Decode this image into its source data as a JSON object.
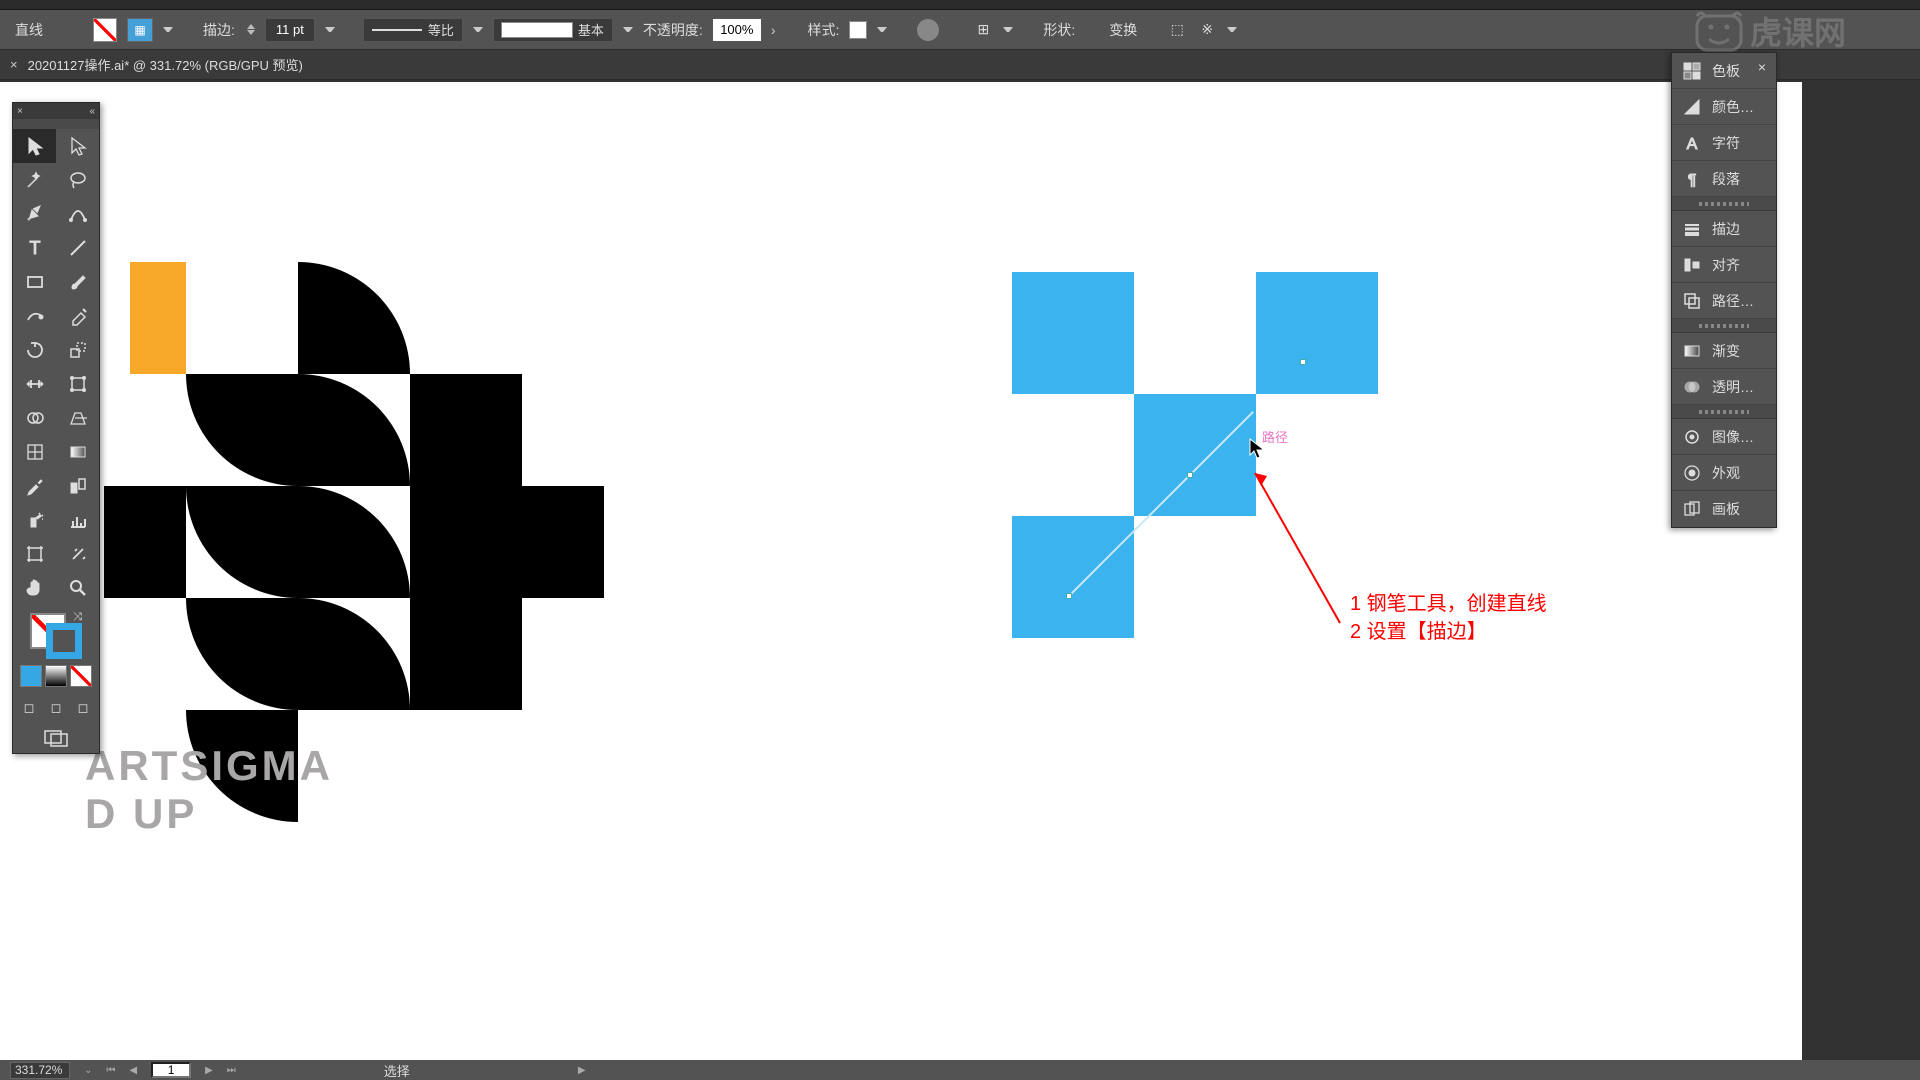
{
  "topbar": {},
  "optionbar": {
    "tool_label": "直线",
    "stroke_label": "描边:",
    "stroke_value": "11 pt",
    "profile_label": "等比",
    "brush_label": "基本",
    "opacity_label": "不透明度:",
    "opacity_value": "100%",
    "style_label": "样式:",
    "shape_label": "形状:",
    "transform_label": "变换"
  },
  "document": {
    "tab_close": "×",
    "tab_label": "20201127操作.ai* @ 331.72% (RGB/GPU 预览)"
  },
  "tools": {
    "close": "×",
    "collapse": "«"
  },
  "right_panel": {
    "items": [
      {
        "icon": "swatches",
        "label": "色板"
      },
      {
        "icon": "color",
        "label": "颜色…"
      },
      {
        "icon": "char",
        "label": "字符"
      },
      {
        "icon": "para",
        "label": "段落"
      }
    ],
    "group2": [
      {
        "icon": "stroke",
        "label": "描边"
      },
      {
        "icon": "align",
        "label": "对齐"
      },
      {
        "icon": "path",
        "label": "路径…"
      }
    ],
    "group3": [
      {
        "icon": "gradient",
        "label": "渐变"
      },
      {
        "icon": "transp",
        "label": "透明…"
      }
    ],
    "group4": [
      {
        "icon": "image",
        "label": "图像…"
      },
      {
        "icon": "appear",
        "label": "外观"
      },
      {
        "icon": "artboard",
        "label": "画板"
      }
    ]
  },
  "canvas": {
    "text_line_1": "ARTSIGMA",
    "text_line_2": "D UP",
    "path_hint": "路径",
    "annotation_line_1": "1 钢笔工具，创建直线",
    "annotation_line_2": "2 设置【描边】"
  },
  "statusbar": {
    "zoom": "331.72%",
    "page": "1",
    "tool_text": "选择"
  },
  "watermark": {
    "text": "虎课网"
  }
}
